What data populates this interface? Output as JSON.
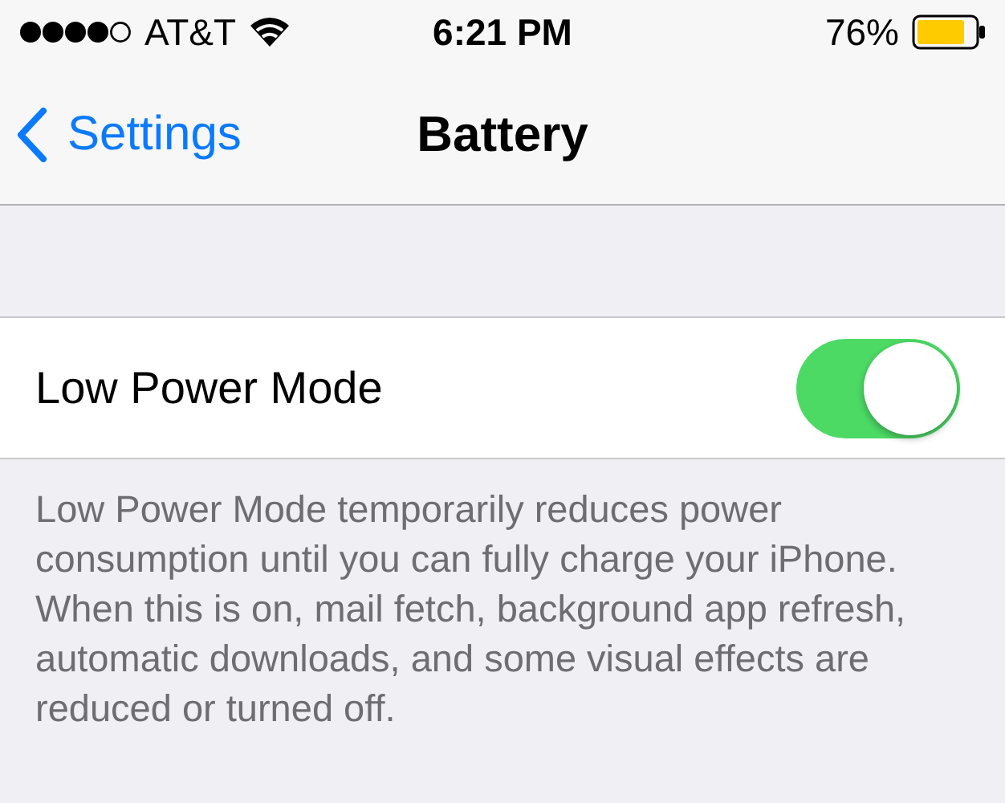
{
  "status_bar": {
    "carrier": "AT&T",
    "time": "6:21 PM",
    "battery": "76%"
  },
  "nav": {
    "back": "Settings",
    "title": "Battery"
  },
  "setting": {
    "label": "Low Power Mode",
    "on": true
  },
  "footer": "Low Power Mode temporarily reduces power consumption until you can fully charge your iPhone. When this is on, mail fetch, background app refresh, automatic downloads, and some visual effects are reduced or turned off."
}
